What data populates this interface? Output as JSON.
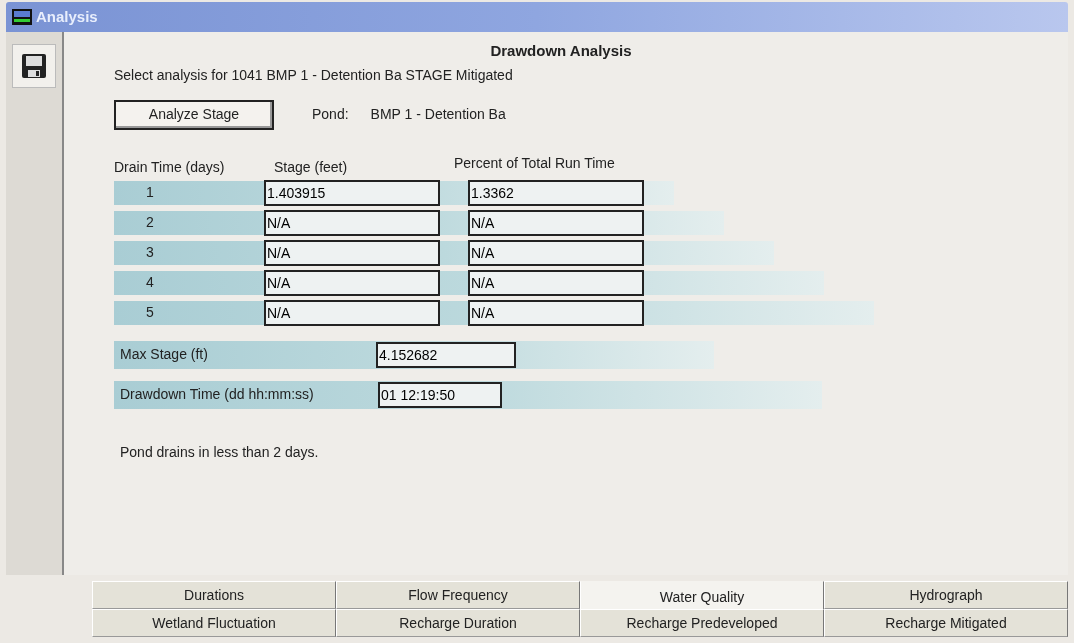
{
  "window": {
    "title": "Analysis"
  },
  "heading": "Drawdown Analysis",
  "select_label": "Select analysis for  1041 BMP 1 - Detention Ba STAGE Mitigated",
  "analyze_button": "Analyze Stage",
  "pond": {
    "label": "Pond:",
    "value": "BMP 1 - Detention Ba"
  },
  "table": {
    "columns": [
      "Drain Time (days)",
      "Stage (feet)",
      "Percent of Total Run Time"
    ],
    "rows": [
      {
        "day": "1",
        "stage": "1.403915",
        "percent": "1.3362"
      },
      {
        "day": "2",
        "stage": "N/A",
        "percent": "N/A"
      },
      {
        "day": "3",
        "stage": "N/A",
        "percent": "N/A"
      },
      {
        "day": "4",
        "stage": "N/A",
        "percent": "N/A"
      },
      {
        "day": "5",
        "stage": "N/A",
        "percent": "N/A"
      }
    ]
  },
  "max_stage": {
    "label": "Max Stage (ft)",
    "value": "4.152682"
  },
  "drawdown_time": {
    "label": "Drawdown Time (dd hh:mm:ss)",
    "value": "01 12:19:50"
  },
  "message": "Pond drains in less than 2 days.",
  "tab_rows": [
    [
      {
        "label": "Durations",
        "selected": false
      },
      {
        "label": "Flow Frequency",
        "selected": false
      },
      {
        "label": "Water Quality",
        "selected": true
      },
      {
        "label": "Hydrograph",
        "selected": false
      }
    ],
    [
      {
        "label": "Wetland Fluctuation",
        "selected": false
      },
      {
        "label": "Recharge Duration",
        "selected": false
      },
      {
        "label": "Recharge Predeveloped",
        "selected": false
      },
      {
        "label": "Recharge Mitigated",
        "selected": false
      }
    ]
  ]
}
